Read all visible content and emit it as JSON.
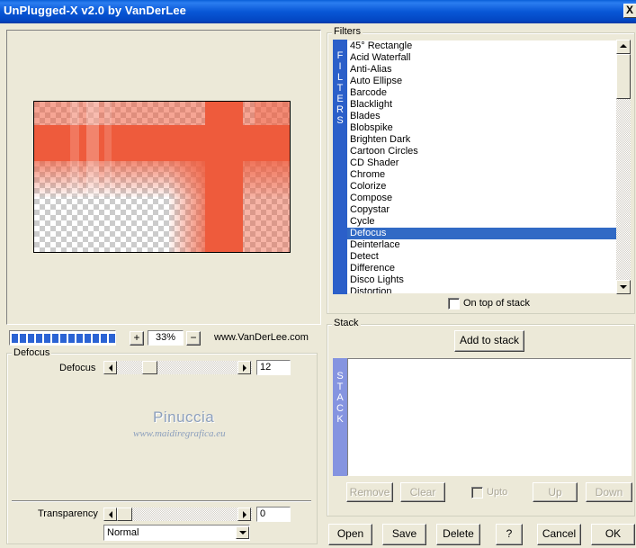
{
  "window": {
    "title": "UnPlugged-X v2.0 by VanDerLee",
    "close_glyph": "X"
  },
  "preview": {
    "zoom": "33%",
    "zoom_in": "+",
    "zoom_out": "−",
    "website": "www.VanDerLee.com",
    "progress_blocks": 13,
    "accent_color": "#ee5b3c"
  },
  "params": {
    "group_label": "Defocus",
    "defocus_label": "Defocus",
    "defocus_value": "12",
    "transparency_label": "Transparency",
    "transparency_value": "0",
    "blend_mode": "Normal"
  },
  "watermark": {
    "name": "Pinuccia",
    "url": "www.maidiregrafica.eu"
  },
  "filters": {
    "group_label": "Filters",
    "side_tab": [
      "F",
      "I",
      "L",
      "T",
      "E",
      "R",
      "S"
    ],
    "items": [
      "45° Rectangle",
      "Acid Waterfall",
      "Anti-Alias",
      "Auto Ellipse",
      "Barcode",
      "Blacklight",
      "Blades",
      "Blobspike",
      "Brighten Dark",
      "Cartoon Circles",
      "CD Shader",
      "Chrome",
      "Colorize",
      "Compose",
      "Copystar",
      "Cycle",
      "Defocus",
      "Deinterlace",
      "Detect",
      "Difference",
      "Disco Lights",
      "Distortion"
    ],
    "selected_index": 16,
    "on_top_label": "On top of stack"
  },
  "stack": {
    "group_label": "Stack",
    "add_button": "Add to stack",
    "side_tab": [
      "S",
      "T",
      "A",
      "C",
      "K"
    ],
    "remove": "Remove",
    "clear": "Clear",
    "upto": "Upto",
    "up": "Up",
    "down": "Down"
  },
  "footer": {
    "open": "Open",
    "save": "Save",
    "delete": "Delete",
    "help": "?",
    "cancel": "Cancel",
    "ok": "OK"
  }
}
